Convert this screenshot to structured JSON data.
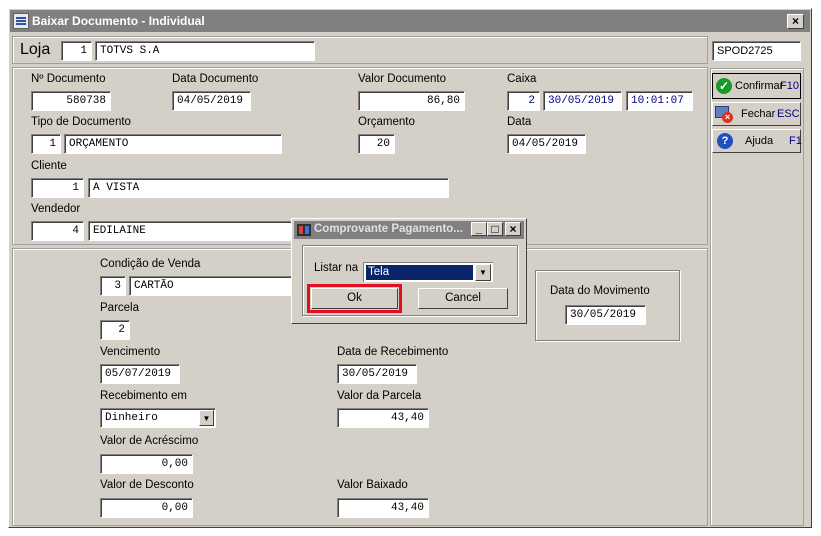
{
  "window": {
    "title": "Baixar Documento - Individual",
    "close_label": "×"
  },
  "loja": {
    "label": "Loja",
    "code": "1",
    "name": "TOTVS S.A"
  },
  "station_code": "SPOD2725",
  "sidebar": {
    "confirmar": {
      "label": "Confirmar",
      "key": "F10"
    },
    "fechar": {
      "label": "Fechar",
      "key": "ESC"
    },
    "ajuda": {
      "label": "Ajuda",
      "key": "F1"
    }
  },
  "document": {
    "numero": {
      "label": "Nº Documento",
      "value": "580738"
    },
    "data_documento": {
      "label": "Data Documento",
      "value": "04/05/2019"
    },
    "valor_documento": {
      "label": "Valor Documento",
      "value": "86,80"
    },
    "caixa": {
      "label": "Caixa",
      "number": "2",
      "date": "30/05/2019",
      "time": "10:01:07"
    },
    "tipo": {
      "label": "Tipo de Documento",
      "code": "1",
      "name": "ORÇAMENTO"
    },
    "orcamento": {
      "label": "Orçamento",
      "value": "20"
    },
    "data": {
      "label": "Data",
      "value": "04/05/2019"
    },
    "cliente": {
      "label": "Cliente",
      "code": "1",
      "name": "A VISTA"
    },
    "vendedor": {
      "label": "Vendedor",
      "code": "4",
      "name": "EDILAINE"
    }
  },
  "payment": {
    "condicao": {
      "label": "Condição de Venda",
      "code": "3",
      "name": "CARTÃO"
    },
    "parcela": {
      "label": "Parcela",
      "value": "2"
    },
    "vencimento": {
      "label": "Vencimento",
      "value": "05/07/2019"
    },
    "data_recebimento": {
      "label": "Data de Recebimento",
      "value": "30/05/2019"
    },
    "recebimento_em": {
      "label": "Recebimento em",
      "value": "Dinheiro"
    },
    "valor_parcela": {
      "label": "Valor da Parcela",
      "value": "43,40"
    },
    "valor_acrescimo": {
      "label": "Valor de Acréscimo",
      "value": "0,00"
    },
    "valor_desconto": {
      "label": "Valor de Desconto",
      "value": "0,00"
    },
    "valor_baixado": {
      "label": "Valor Baixado",
      "value": "43,40"
    },
    "data_movimento": {
      "label": "Data do Movimento",
      "value": "30/05/2019"
    }
  },
  "dialog": {
    "title": "Comprovante Pagamento...",
    "listar_label": "Listar na",
    "listar_value": "Tela",
    "ok_label": "Ok",
    "cancel_label": "Cancel",
    "min_label": "_",
    "max_label": "□",
    "close_label": "×"
  },
  "colors": {
    "highlight_border": "#e01020",
    "selection": "#0a246a",
    "titlebar": "#808080"
  }
}
